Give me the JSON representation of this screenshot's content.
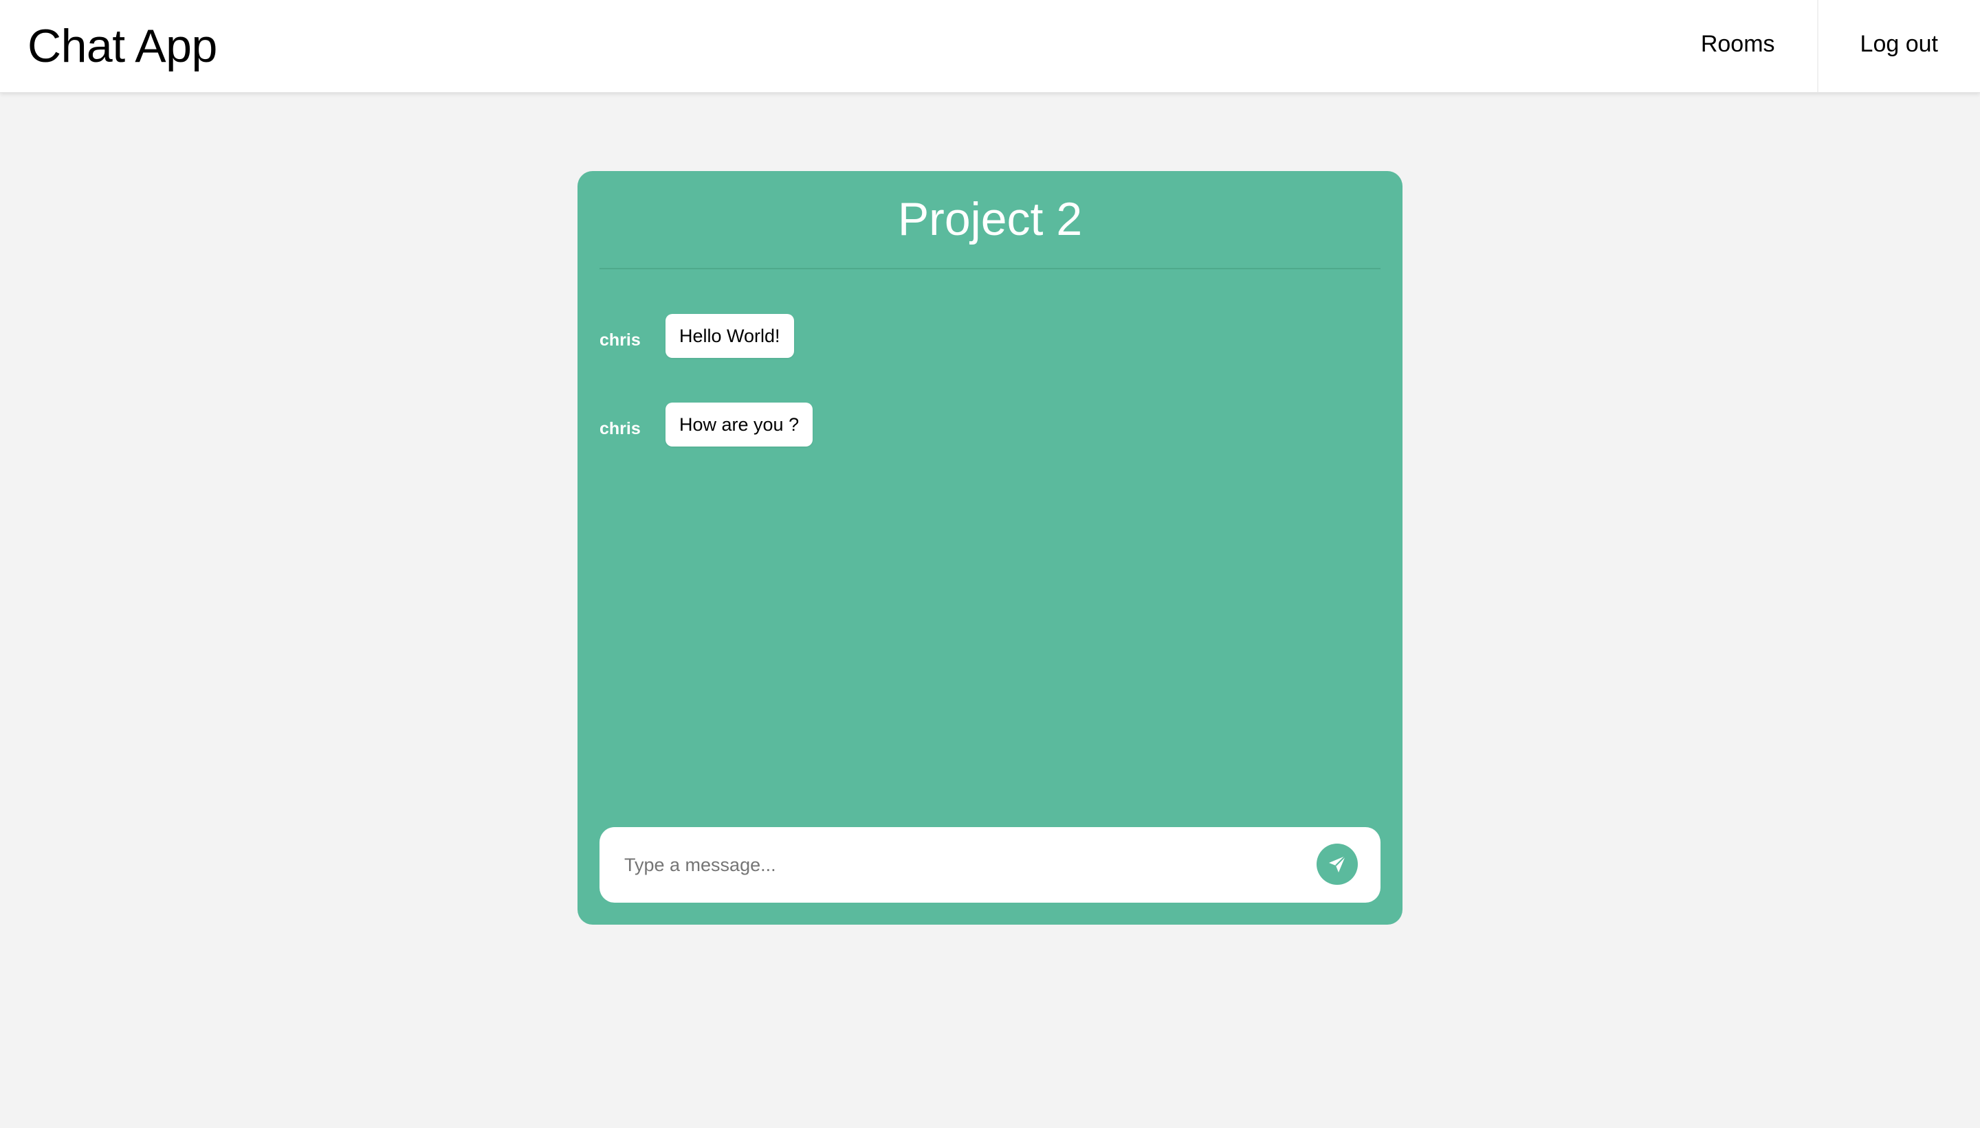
{
  "app": {
    "title": "Chat App"
  },
  "nav": {
    "items": [
      {
        "label": "Rooms"
      },
      {
        "label": "Log out"
      }
    ]
  },
  "room": {
    "title": "Project 2"
  },
  "messages": [
    {
      "user": "chris",
      "text": "Hello World!"
    },
    {
      "user": "chris",
      "text": "How are you ?"
    }
  ],
  "composer": {
    "placeholder": "Type a message...",
    "value": "",
    "send_icon": "send-icon"
  },
  "colors": {
    "accent": "#5bba9d",
    "page_background": "#f3f3f3",
    "surface": "#ffffff"
  }
}
